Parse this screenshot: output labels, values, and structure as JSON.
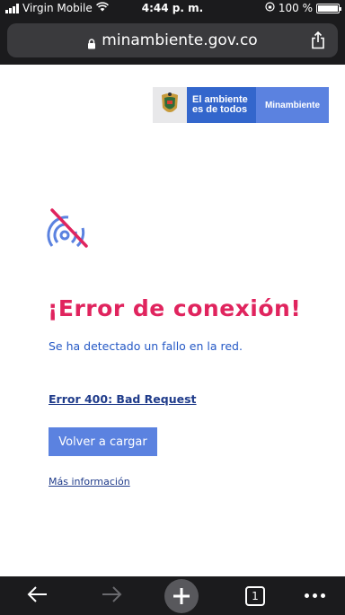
{
  "status_bar": {
    "carrier": "Virgin Mobile",
    "time": "4:44 p. m.",
    "battery": "100 %"
  },
  "browser": {
    "url": "minambiente.gov.co",
    "tab_count": "1"
  },
  "brand": {
    "slogan_line1": "El ambiente",
    "slogan_line2": "es de todos",
    "name": "Minambiente"
  },
  "error": {
    "title": "¡Error de conexión!",
    "description": "Se ha detectado un fallo en la red.",
    "code": "Error 400: Bad Request",
    "reload_label": "Volver a cargar",
    "more_info_label": "Más información"
  },
  "colors": {
    "error_title": "#e0245e",
    "accent": "#5b82e0",
    "brand_blue": "#3366cc",
    "chrome": "#1b1b1d"
  }
}
